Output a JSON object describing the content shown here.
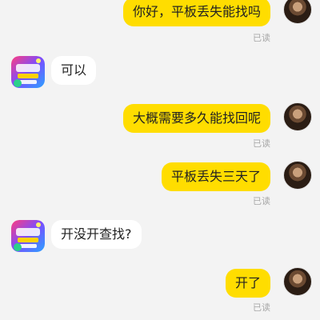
{
  "messages": [
    {
      "side": "me",
      "text": "你好，平板丢失能找吗",
      "read": "已读"
    },
    {
      "side": "them",
      "text": "可以"
    },
    {
      "side": "me",
      "text": "大概需要多久能找回呢",
      "read": "已读"
    },
    {
      "side": "me",
      "text": "平板丢失三天了",
      "read": "已读"
    },
    {
      "side": "them",
      "text": "开没开查找?"
    },
    {
      "side": "me",
      "text": "开了",
      "read": "已读"
    }
  ],
  "colors": {
    "background": "#f3f3f3",
    "my_bubble": "#ffdd00",
    "their_bubble": "#ffffff",
    "read_receipt": "#a8a8a8"
  },
  "icons": {
    "my_avatar": "user-photo-avatar",
    "their_avatar": "shop-logo-avatar"
  }
}
